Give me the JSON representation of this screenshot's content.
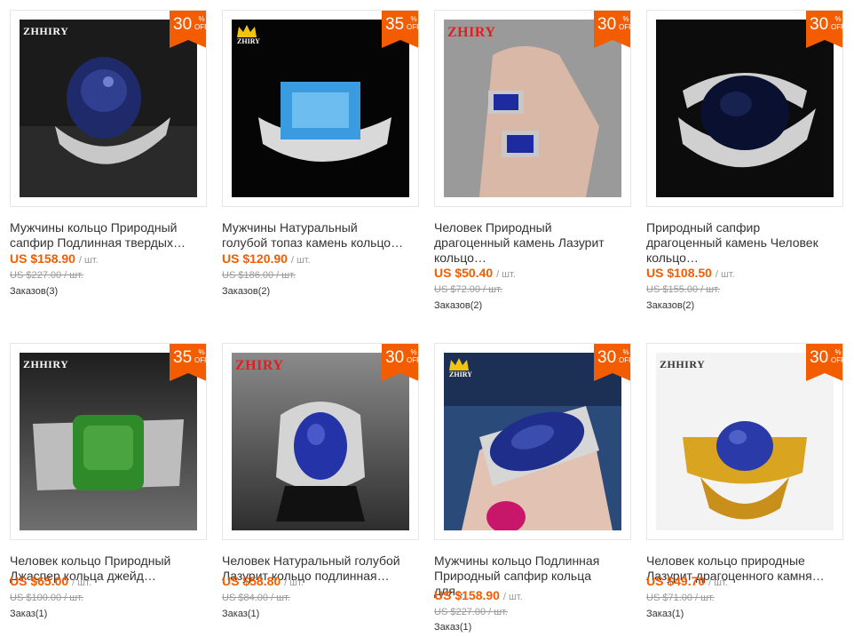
{
  "products": [
    {
      "title_line1": "Мужчины кольцо Природный",
      "title_line2": "сапфир Подлинная твердых…",
      "title_line3": "",
      "price": "US $158.90",
      "unit": "/ шт.",
      "old_price": "US $227.00 / шт.",
      "orders": "Заказов(3)",
      "discount": "30",
      "discount_sign": "%",
      "discount_off": "OFF",
      "brand": "ZHHIRY",
      "icon": "ring-photo-dark-sapphire"
    },
    {
      "title_line1": "Мужчины Натуральный",
      "title_line2": "голубой топаз камень кольцо…",
      "title_line3": "",
      "price": "US $120.90",
      "unit": "/ шт.",
      "old_price": "US $186.00 / шт.",
      "orders": "Заказов(2)",
      "discount": "35",
      "discount_sign": "%",
      "discount_off": "OFF",
      "brand": "ZHIRY",
      "icon": "ring-photo-blue-topaz"
    },
    {
      "title_line1": "Человек Природный",
      "title_line2": "драгоценный камень Лазурит",
      "title_line3": "кольцо…",
      "price": "US $50.40",
      "unit": "/ шт.",
      "old_price": "US $72.00 / шт.",
      "orders": "Заказов(2)",
      "discount": "30",
      "discount_sign": "%",
      "discount_off": "OFF",
      "brand": "ZHIRY",
      "icon": "ring-photo-lapis-hand"
    },
    {
      "title_line1": "Природный сапфир",
      "title_line2": "драгоценный камень Человек",
      "title_line3": "кольцо…",
      "price": "US $108.50",
      "unit": "/ шт.",
      "old_price": "US $155.00 / шт.",
      "orders": "Заказов(2)",
      "discount": "30",
      "discount_sign": "%",
      "discount_off": "OFF",
      "brand": "",
      "icon": "ring-photo-black-sapphire"
    },
    {
      "title_line1": "Человек кольцо Природный",
      "title_line2": "Джаспер кольца джейд…",
      "title_line3": "",
      "price": "US $65.00",
      "unit": "/ шт.",
      "old_price": "US $100.00 / шт.",
      "orders": "Заказ(1)",
      "discount": "35",
      "discount_sign": "%",
      "discount_off": "OFF",
      "brand": "ZHHIRY",
      "icon": "ring-photo-green-jasper"
    },
    {
      "title_line1": "Человек Натуральный голубой",
      "title_line2": "Лазурит кольцо подлинная…",
      "title_line3": "",
      "price": "US $58.80",
      "unit": "/ шт.",
      "old_price": "US $84.00 / шт.",
      "orders": "Заказ(1)",
      "discount": "30",
      "discount_sign": "%",
      "discount_off": "OFF",
      "brand": "ZHIRY",
      "icon": "ring-photo-lapis-oval"
    },
    {
      "title_line1": "Мужчины кольцо Подлинная",
      "title_line2": "Природный сапфир кольца",
      "title_line3": "для…",
      "price": "US $158.90",
      "unit": "/ шт.",
      "old_price": "US $227.00 / шт.",
      "orders": "Заказ(1)",
      "discount": "30",
      "discount_sign": "%",
      "discount_off": "OFF",
      "brand": "ZHIRY",
      "icon": "ring-photo-sapphire-hand"
    },
    {
      "title_line1": "Человек кольцо природные",
      "title_line2": "Лазурит драгоценного камня…",
      "title_line3": "",
      "price": "US $49.70",
      "unit": "/ шт.",
      "old_price": "US $71.00 / шт.",
      "orders": "Заказ(1)",
      "discount": "30",
      "discount_sign": "%",
      "discount_off": "OFF",
      "brand": "ZHHIRY",
      "icon": "ring-photo-gold-lapis"
    }
  ],
  "colors": {
    "badge": "#f45c00",
    "price": "#f45c00",
    "text": "#333333",
    "muted": "#999999"
  }
}
